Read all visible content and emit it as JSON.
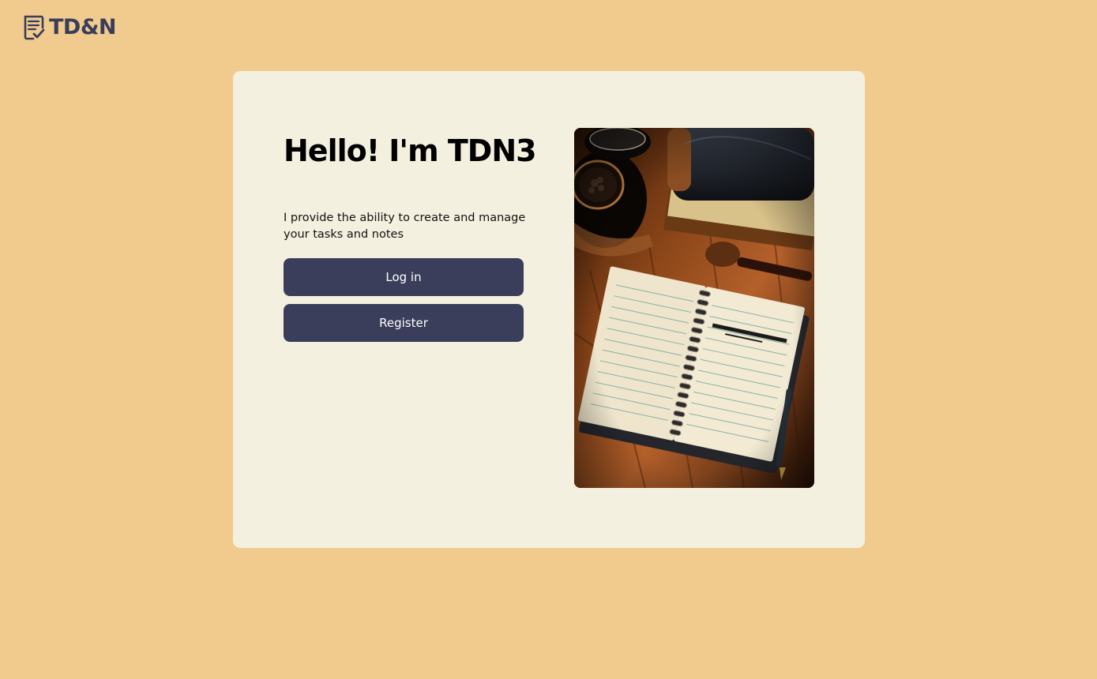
{
  "header": {
    "logo_text": "TD&N",
    "logo_icon": "notepad-check-icon",
    "brand_color": "#3a3d5a"
  },
  "page": {
    "background_color": "#f1cb8d",
    "card_color": "#f4f0df"
  },
  "welcome": {
    "title": "Hello! I'm TDN3",
    "description": "I provide the ability to create and manage your tasks and notes",
    "login_label": "Log in",
    "register_label": "Register",
    "button_color": "#3a3e5a"
  },
  "hero_image": {
    "subject": "spiral-notebook-on-wooden-desk-image"
  }
}
